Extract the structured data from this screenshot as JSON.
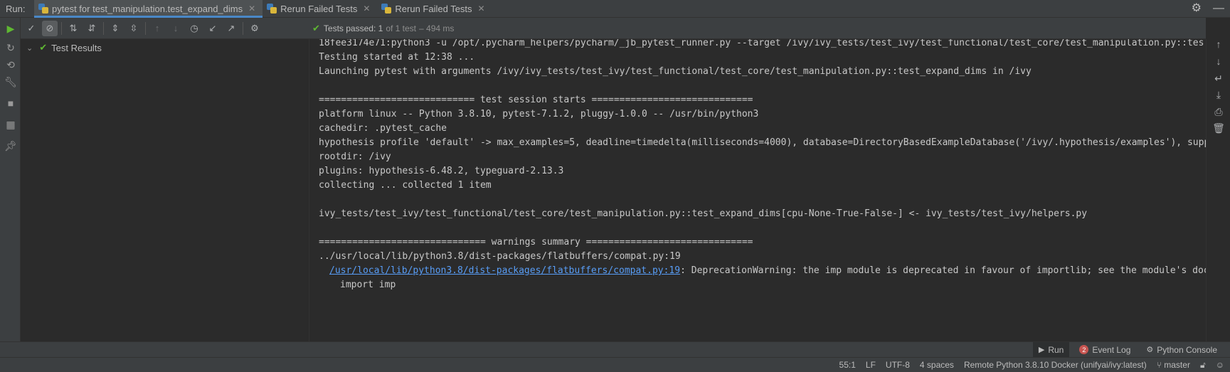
{
  "run_label": "Run:",
  "tabs": [
    {
      "label": "pytest for test_manipulation.test_expand_dims",
      "active": true
    },
    {
      "label": "Rerun Failed Tests",
      "active": false
    },
    {
      "label": "Rerun Failed Tests",
      "active": false
    }
  ],
  "status": {
    "prefix": "Tests passed:",
    "passed": "1",
    "suffix": "of 1 test",
    "duration": "– 494 ms"
  },
  "tree": {
    "root_label": "Test Results"
  },
  "console": {
    "lines": [
      "18fee3174e71:python3 -u /opt/.pycharm_helpers/pycharm/_jb_pytest_runner.py --target /ivy/ivy_tests/test_ivy/test_functional/test_core/test_manipulation.py::tes",
      "Testing started at 12:38 ...",
      "Launching pytest with arguments /ivy/ivy_tests/test_ivy/test_functional/test_core/test_manipulation.py::test_expand_dims in /ivy",
      "",
      "============================ test session starts =============================",
      "platform linux -- Python 3.8.10, pytest-7.1.2, pluggy-1.0.0 -- /usr/bin/python3",
      "cachedir: .pytest_cache",
      "hypothesis profile 'default' -> max_examples=5, deadline=timedelta(milliseconds=4000), database=DirectoryBasedExampleDatabase('/ivy/.hypothesis/examples'), supp",
      "rootdir: /ivy",
      "plugins: hypothesis-6.48.2, typeguard-2.13.3",
      "collecting ... collected 1 item",
      "",
      "ivy_tests/test_ivy/test_functional/test_core/test_manipulation.py::test_expand_dims[cpu-None-True-False-] <- ivy_tests/test_ivy/helpers.py",
      "",
      "============================== warnings summary ==============================",
      "../usr/local/lib/python3.8/dist-packages/flatbuffers/compat.py:19"
    ],
    "warning_link": "/usr/local/lib/python3.8/dist-packages/flatbuffers/compat.py:19",
    "warning_text": ": DeprecationWarning: the imp module is deprecated in favour of importlib; see the module's doc",
    "import_line": "import imp"
  },
  "bottom_tools": {
    "run": "Run",
    "event_log": "Event Log",
    "event_count": "2",
    "python_console": "Python Console"
  },
  "statusbar": {
    "position": "55:1",
    "line_sep": "LF",
    "encoding": "UTF-8",
    "indent": "4 spaces",
    "interpreter": "Remote Python 3.8.10 Docker (unifyai/ivy:latest)",
    "branch": "master"
  },
  "icons": {
    "run": "play-icon",
    "pass": "check-icon",
    "settings": "gear-icon",
    "minimize": "minimize-icon"
  },
  "colors": {
    "accent": "#4a88c7",
    "pass": "#5fb832",
    "link": "#589df6",
    "background": "#2b2b2b",
    "panel": "#3c3f41"
  }
}
